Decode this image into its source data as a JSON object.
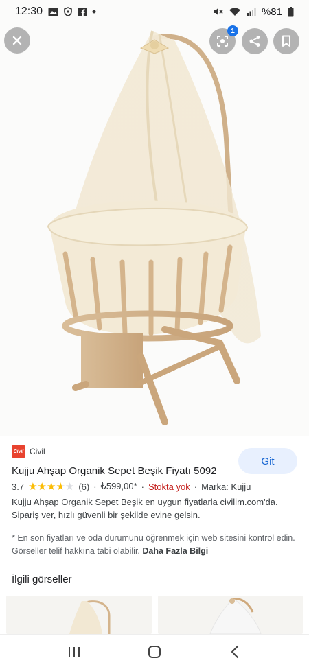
{
  "status_bar": {
    "time": "12:30",
    "battery": "%81",
    "left_icons": [
      "image-icon",
      "shield-icon",
      "facebook-icon",
      "dot-icon"
    ],
    "right_icons": [
      "mute-icon",
      "wifi-icon",
      "signal-icon",
      "battery-icon"
    ]
  },
  "hero": {
    "close_icon": "close-icon",
    "lens_icon": "lens-icon",
    "lens_badge": "1",
    "share_icon": "share-icon",
    "bookmark_icon": "bookmark-icon"
  },
  "result": {
    "source_logo": "Civil",
    "source_name": "Civil",
    "go_label": "Git",
    "title": "Kujju Ahşap Organik Sepet Beşik Fiyatı 5092",
    "rating": "3.7",
    "rating_value": 3.7,
    "rating_max": 5,
    "review_count": "(6)",
    "separator": "·",
    "price": "₺599,00*",
    "stock": "Stokta yok",
    "brand": "Marka: Kujju",
    "description": "Kujju Ahşap Organik Sepet Beşik en uygun fiyatlarla civilim.com'da. Sipariş ver, hızlı güvenli bir şekilde evine gelsin.",
    "note": "* En son fiyatları ve oda durumunu öğrenmek için web sitesini kontrol edin. Görseller telif hakkına tabi olabilir.",
    "more_info": "Daha Fazla Bilgi"
  },
  "related": {
    "title": "İlgili görseller"
  },
  "nav": {
    "recent_icon": "recent-apps-icon",
    "home_icon": "home-icon",
    "back_icon": "back-icon"
  },
  "colors": {
    "accent": "#1a73e8",
    "go_bg": "#e8f0fe",
    "stock": "#c5221f",
    "star": "#fbbc04",
    "logo": "#e8432f"
  }
}
